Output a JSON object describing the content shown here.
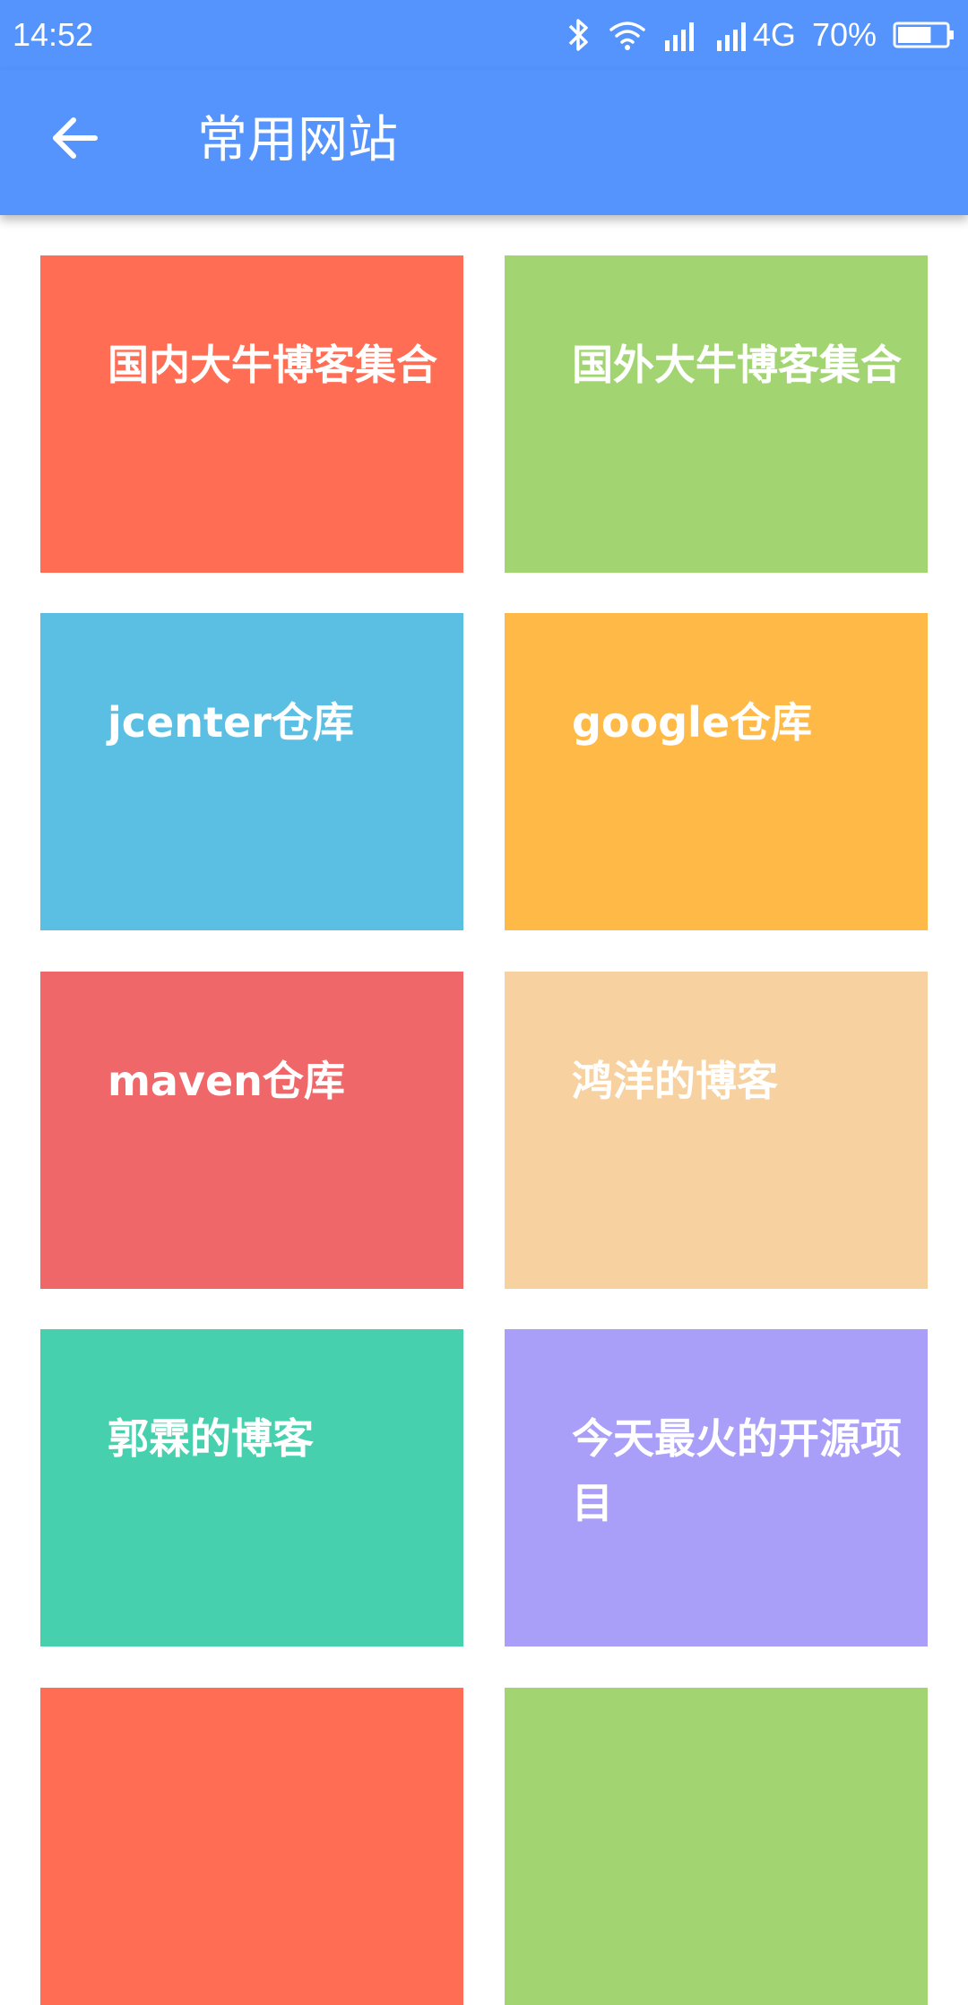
{
  "status_bar": {
    "time": "14:52",
    "network": "4G",
    "battery": "70%",
    "battery_level": 0.7,
    "icons": [
      "bluetooth-icon",
      "wifi-icon",
      "signal-icon",
      "signal-icon",
      "battery-icon"
    ]
  },
  "app_bar": {
    "title": "常用网站",
    "back_icon": "arrow-left-icon",
    "color": "#5594fd"
  },
  "tiles": [
    {
      "label": "国内大牛博客集合",
      "color": "#ff6e54"
    },
    {
      "label": "国外大牛博客集合",
      "color": "#a2d572"
    },
    {
      "label": "jcenter仓库",
      "color": "#5bbfe3"
    },
    {
      "label": "google仓库",
      "color": "#ffb946"
    },
    {
      "label": "maven仓库",
      "color": "#ef6769"
    },
    {
      "label": "鸿洋的博客",
      "color": "#f7d19f"
    },
    {
      "label": "郭霖的博客",
      "color": "#47d0ad"
    },
    {
      "label": "今天最火的开源项目",
      "color": "#a99ff8"
    },
    {
      "label": "",
      "color": "#ff6e54"
    },
    {
      "label": "",
      "color": "#a2d572"
    }
  ]
}
